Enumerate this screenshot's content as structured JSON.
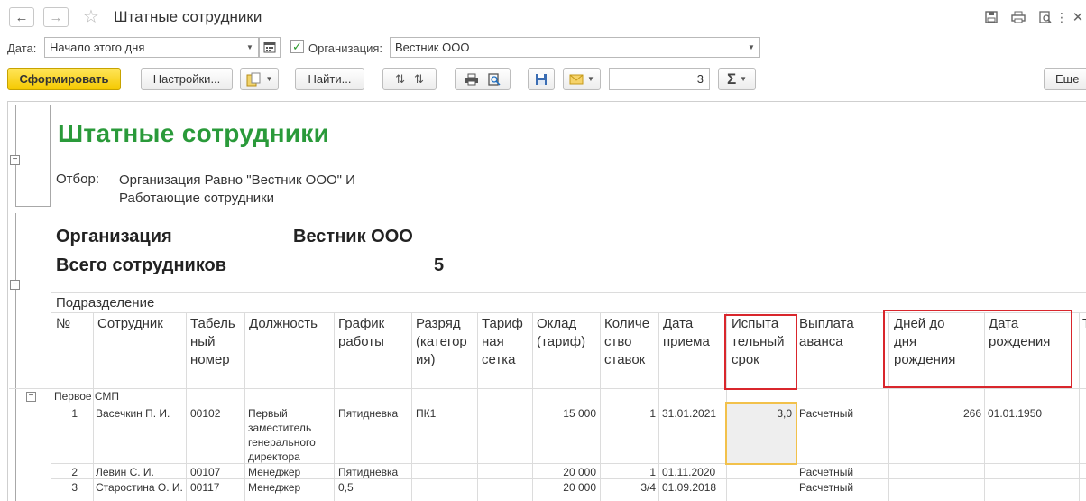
{
  "window": {
    "title": "Штатные сотрудники",
    "back_icon": "arrow-left-icon",
    "forward_icon": "arrow-right-icon",
    "favorite_icon": "star-icon",
    "tools": [
      "save-icon",
      "print-icon",
      "preview-icon",
      "link-icon",
      "close-icon"
    ]
  },
  "filters": {
    "date_label": "Дата:",
    "date_value": "Начало этого дня",
    "org_checked": true,
    "org_label": "Организация:",
    "org_value": "Вестник ООО"
  },
  "toolbar": {
    "generate": "Сформировать",
    "settings": "Настройки...",
    "find": "Найти...",
    "count_value": "3",
    "sum_symbol": "Σ",
    "more": "Еще"
  },
  "report": {
    "title": "Штатные сотрудники",
    "filter_label": "Отбор:",
    "filter_text_1": "Организация Равно \"Вестник ООО\" И",
    "filter_text_2": "Работающие сотрудники",
    "org_label": "Организация",
    "org_value": "Вестник ООО",
    "total_label": "Всего сотрудников",
    "total_value": "5",
    "section_label": "Подразделение",
    "group_name": "Первое СМП"
  },
  "columns": [
    {
      "key": "num",
      "label": "№"
    },
    {
      "key": "emp",
      "label": "Сотрудник"
    },
    {
      "key": "tab",
      "label": "Табель ный номер"
    },
    {
      "key": "pos",
      "label": "Должность"
    },
    {
      "key": "sched",
      "label": "График работы"
    },
    {
      "key": "grade",
      "label": "Разряд (категор ия)"
    },
    {
      "key": "tariff",
      "label": "Тариф ная сетка"
    },
    {
      "key": "salary",
      "label": "Оклад (тариф)"
    },
    {
      "key": "rates",
      "label": "Количе ство ставок"
    },
    {
      "key": "hire",
      "label": "Дата приема"
    },
    {
      "key": "prob",
      "label": "Испыта тельный срок"
    },
    {
      "key": "adv",
      "label": "Выплата аванса"
    },
    {
      "key": "days",
      "label": "Дней до дня рождения"
    },
    {
      "key": "birth",
      "label": "Дата рождения"
    },
    {
      "key": "extra",
      "label": "Т"
    }
  ],
  "rows": [
    {
      "num": "1",
      "emp": "Васечкин П. И.",
      "tab": "00102",
      "pos": "Первый заместитель генерального директора",
      "sched": "Пятидневка",
      "grade": "ПК1",
      "tariff": "",
      "salary": "15 000",
      "rates": "1",
      "hire": "31.01.2021",
      "prob": "3,0",
      "adv": "Расчетный",
      "days": "266",
      "birth": "01.01.1950"
    },
    {
      "num": "2",
      "emp": "Левин С. И.",
      "tab": "00107",
      "pos": "Менеджер",
      "sched": "Пятидневка",
      "grade": "",
      "tariff": "",
      "salary": "20 000",
      "rates": "1",
      "hire": "01.11.2020",
      "prob": "",
      "adv": "Расчетный",
      "days": "",
      "birth": ""
    },
    {
      "num": "3",
      "emp": "Старостина О. И.",
      "tab": "00117",
      "pos": "Менеджер",
      "sched": "0,5",
      "grade": "",
      "tariff": "",
      "salary": "20 000",
      "rates": "3/4",
      "hire": "01.09.2018",
      "prob": "",
      "adv": "Расчетный",
      "days": "",
      "birth": ""
    }
  ],
  "colors": {
    "title_green": "#2a9a3a",
    "highlight_red": "#d9262c",
    "selection_yellow": "#f2c14b",
    "primary_button": "#f5c900"
  }
}
